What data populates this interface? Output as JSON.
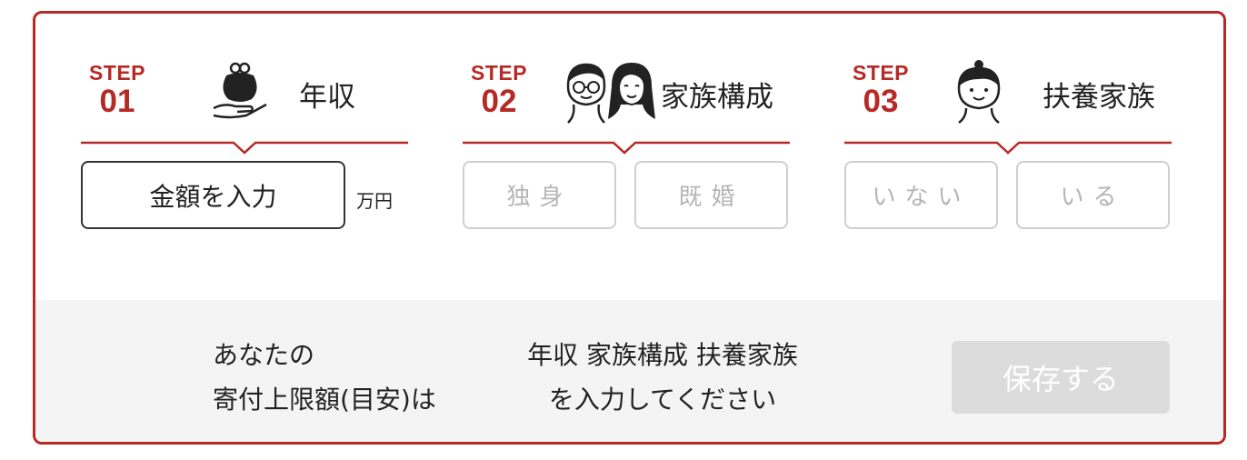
{
  "steps": [
    {
      "step_word": "STEP",
      "number": "01",
      "title": "年収",
      "icon": "purse-in-hand-icon"
    },
    {
      "step_word": "STEP",
      "number": "02",
      "title": "家族構成",
      "icon": "couple-icon"
    },
    {
      "step_word": "STEP",
      "number": "03",
      "title": "扶養家族",
      "icon": "child-icon"
    }
  ],
  "income": {
    "button_label": "金額を入力",
    "unit": "万円"
  },
  "family": {
    "options": [
      "独身",
      "既婚"
    ]
  },
  "dependents": {
    "options": [
      "いない",
      "いる"
    ]
  },
  "result": {
    "label_line1": "あなたの",
    "label_line2": "寄付上限額(目安)は",
    "prompt_line1": "年収 家族構成 扶養家族",
    "prompt_line2": "を入力してください"
  },
  "save_button": "保存する",
  "colors": {
    "accent": "#b62a25",
    "disabled_text": "#b5b5b5",
    "panel_bg": "#f4f4f4",
    "save_bg": "#dcdcdc"
  }
}
